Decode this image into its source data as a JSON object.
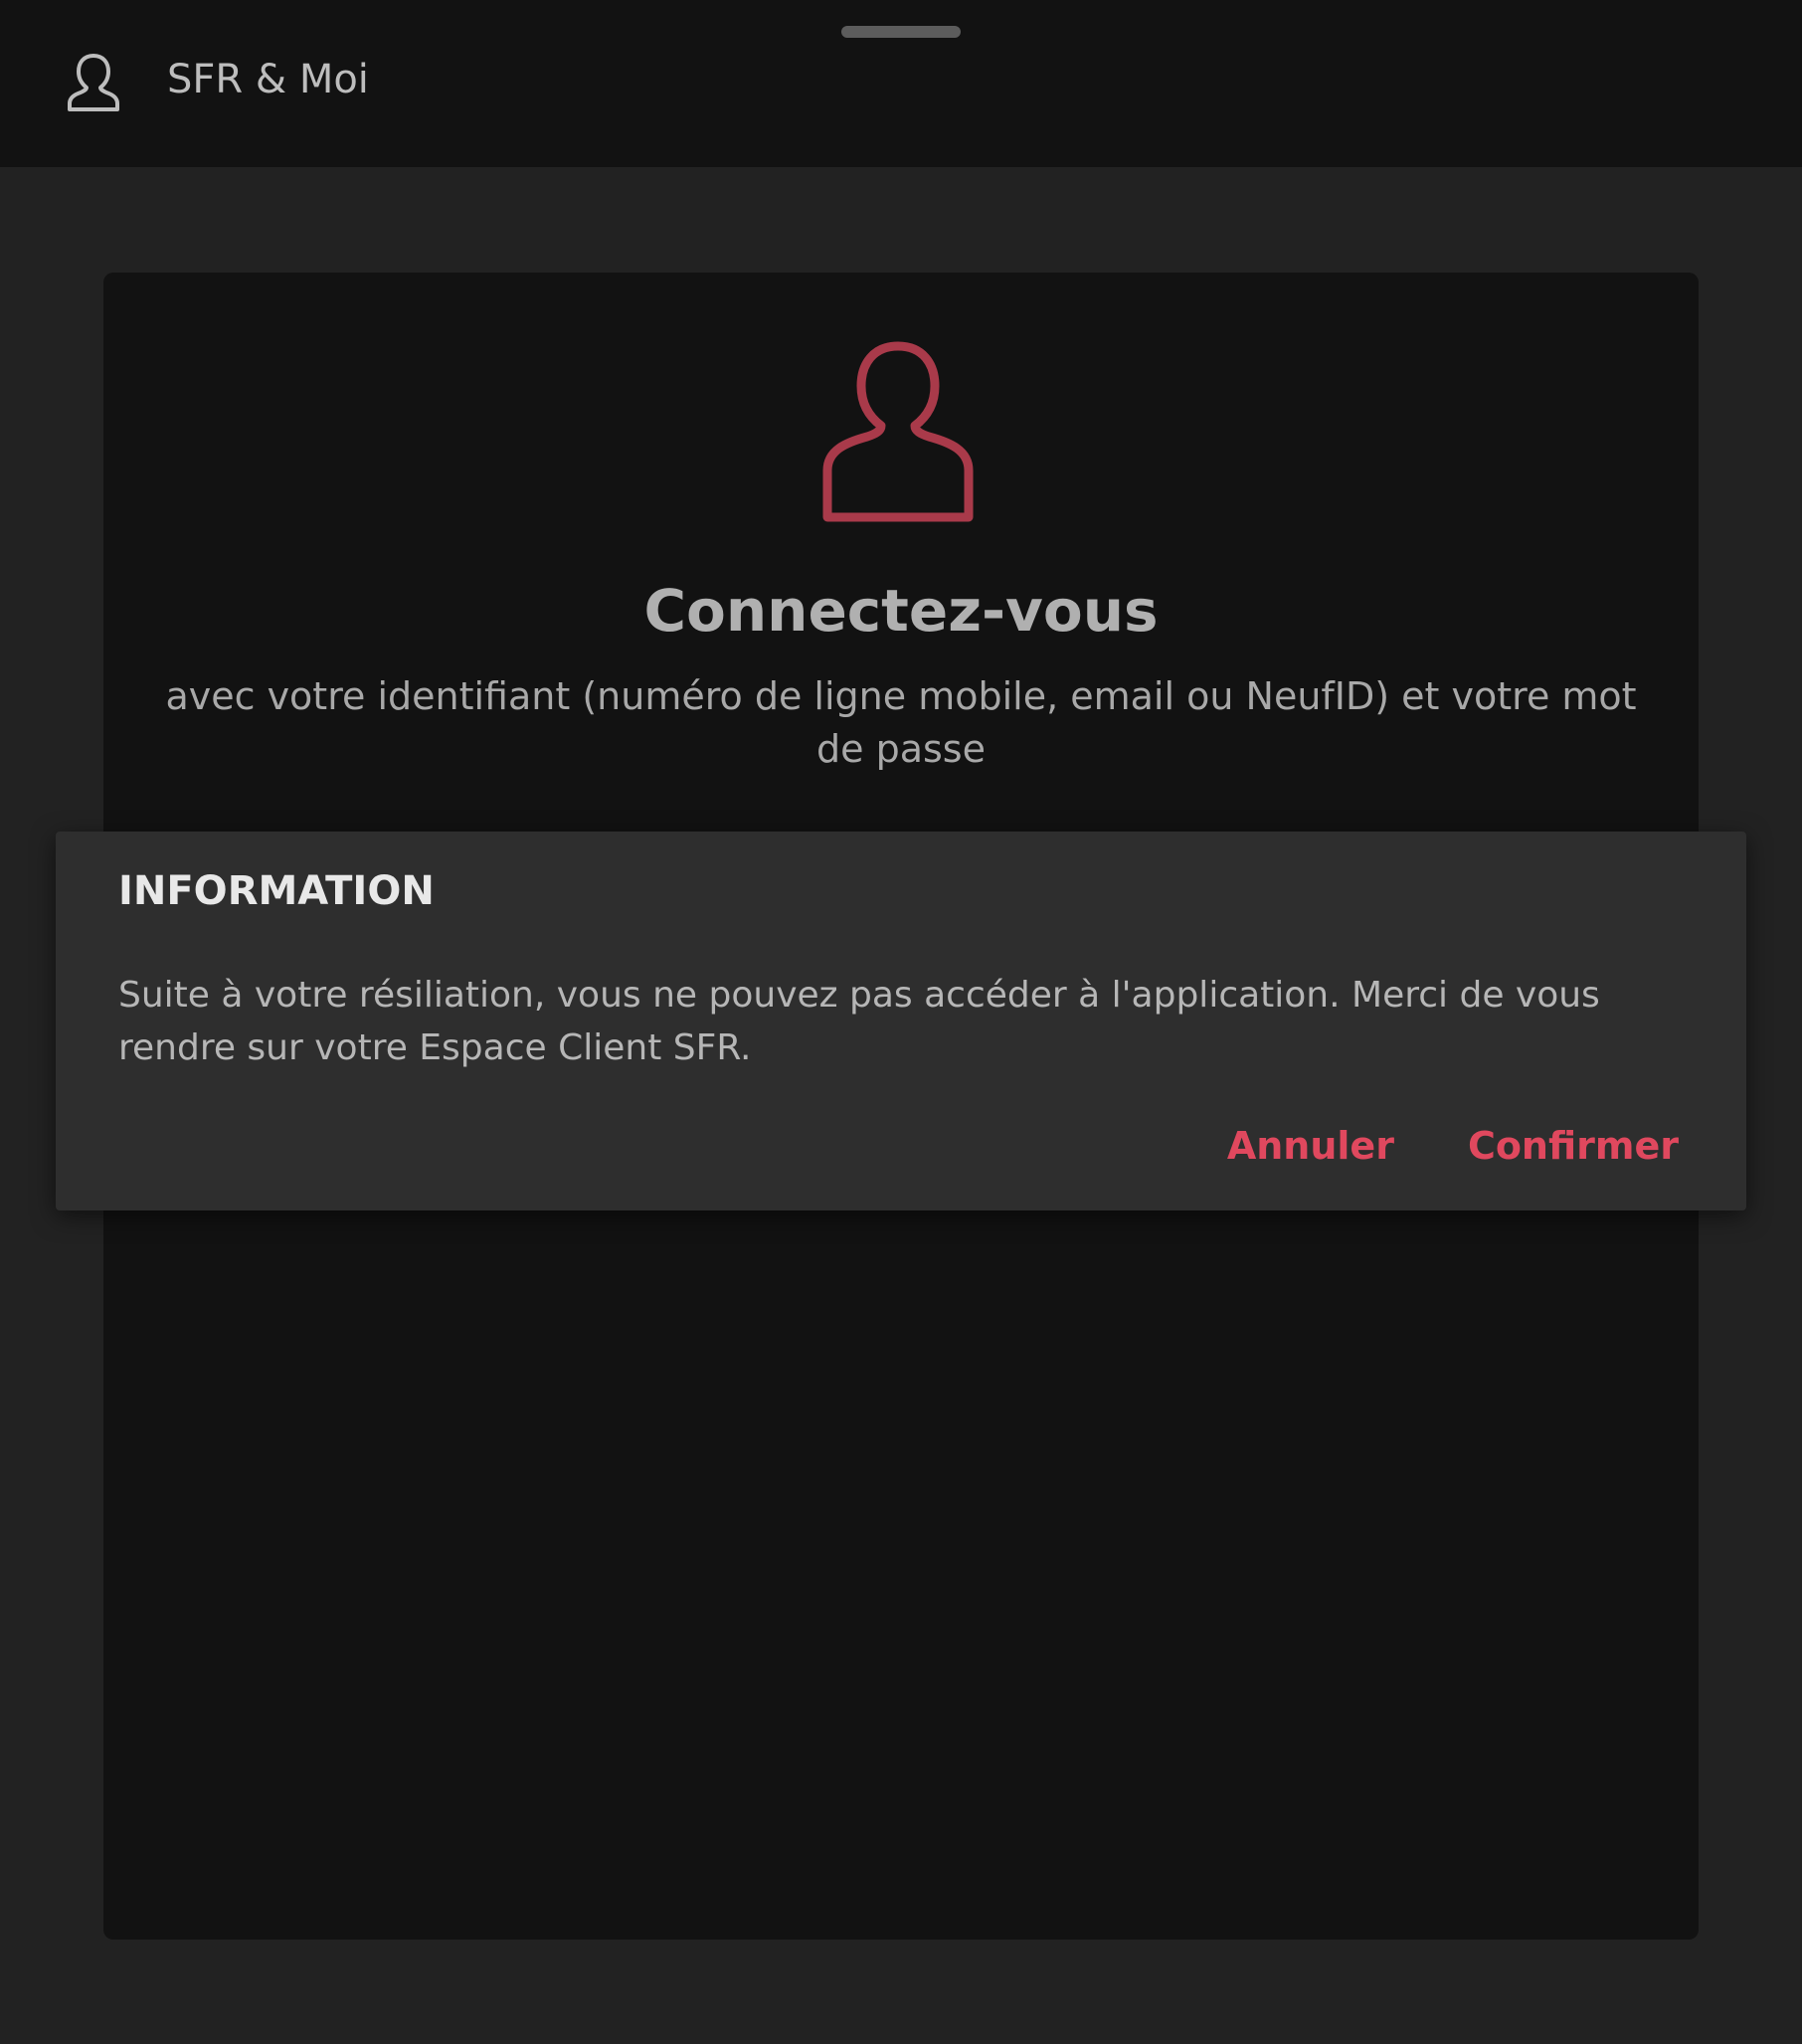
{
  "header": {
    "title": "SFR & Moi",
    "icon": "user-outline-icon"
  },
  "login": {
    "icon": "user-outline-icon",
    "title": "Connectez-vous",
    "subtitle": "avec votre identifiant (numéro de ligne mobile, email ou NeufID) et votre mot de passe"
  },
  "dialog": {
    "title": "INFORMATION",
    "message": "Suite à votre résiliation, vous ne pouvez pas accéder à l'application. Merci de vous rendre sur votre Espace Client SFR.",
    "cancel_label": "Annuler",
    "confirm_label": "Confirmer"
  },
  "colors": {
    "accent": "#e0485e",
    "icon_accent": "#a93a4a",
    "background": "#222222",
    "card": "#121212",
    "dialog": "#2e2e2e"
  }
}
